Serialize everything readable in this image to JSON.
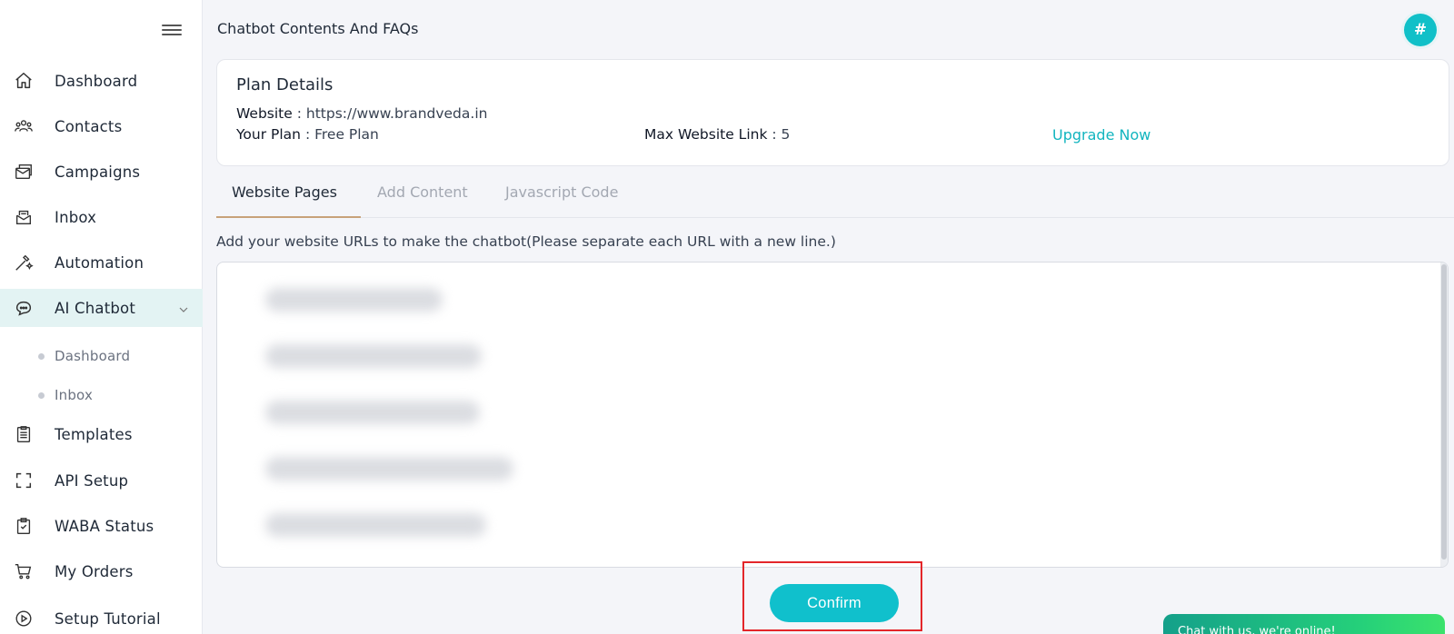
{
  "sidebar": {
    "items": [
      {
        "label": "Dashboard",
        "icon": "home-icon"
      },
      {
        "label": "Contacts",
        "icon": "contacts-icon"
      },
      {
        "label": "Campaigns",
        "icon": "campaigns-icon"
      },
      {
        "label": "Inbox",
        "icon": "inbox-icon"
      },
      {
        "label": "Automation",
        "icon": "automation-icon"
      },
      {
        "label": "AI Chatbot",
        "icon": "chatbot-icon"
      },
      {
        "label": "Templates",
        "icon": "templates-icon"
      },
      {
        "label": "API Setup",
        "icon": "api-icon"
      },
      {
        "label": "WABA Status",
        "icon": "waba-icon"
      },
      {
        "label": "My Orders",
        "icon": "cart-icon"
      },
      {
        "label": "Setup Tutorial",
        "icon": "play-icon"
      }
    ],
    "sub_items": [
      {
        "label": "Dashboard"
      },
      {
        "label": "Inbox"
      }
    ]
  },
  "header": {
    "title": "Chatbot Contents And FAQs",
    "avatar_text": "#"
  },
  "plan": {
    "title": "Plan Details",
    "website_label": "Website",
    "website_value": ": https://www.brandveda.in",
    "plan_label": "Your Plan",
    "plan_value": ": Free Plan",
    "max_label": "Max Website Link",
    "max_value": ": 5",
    "upgrade": "Upgrade Now"
  },
  "tabs": [
    {
      "label": "Website Pages",
      "active": true
    },
    {
      "label": "Add Content",
      "active": false
    },
    {
      "label": "Javascript Code",
      "active": false
    }
  ],
  "hint": "Add your website URLs to make the chatbot(Please separate each URL with a new line.)",
  "confirm_label": "Confirm",
  "chat_widget": "Chat with us, we're online!",
  "colors": {
    "accent": "#10c0cc",
    "active_bg": "#e3f3f3",
    "highlight": "#e3262a",
    "chat_green": "#25d07a"
  }
}
